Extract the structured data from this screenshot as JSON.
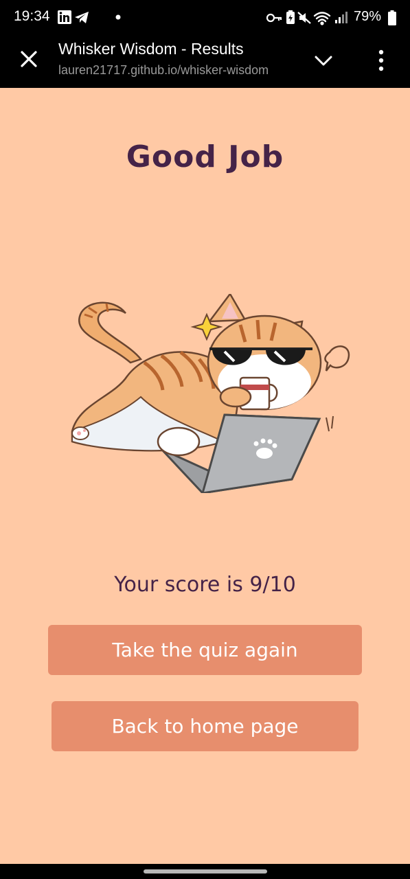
{
  "status_bar": {
    "time": "19:34",
    "battery": "79%",
    "left_icons": [
      "linkedin-icon",
      "telegram-icon",
      "notification-dot-icon"
    ],
    "right_icons": [
      "key-icon",
      "battery-saver-icon",
      "mute-icon",
      "wifi-icon",
      "signal-icon",
      "battery-icon"
    ]
  },
  "browser": {
    "title": "Whisker Wisdom - Results",
    "url": "lauren21717.github.io/whisker-wisdom"
  },
  "results": {
    "heading": "Good Job",
    "score_text": "Your score is 9/10",
    "retry_label": "Take the quiz again",
    "home_label": "Back to home page"
  },
  "colors": {
    "page_background": "#ffc9a5",
    "heading_text": "#452348",
    "button_background": "#e78e6d",
    "button_text": "#ffffff"
  }
}
